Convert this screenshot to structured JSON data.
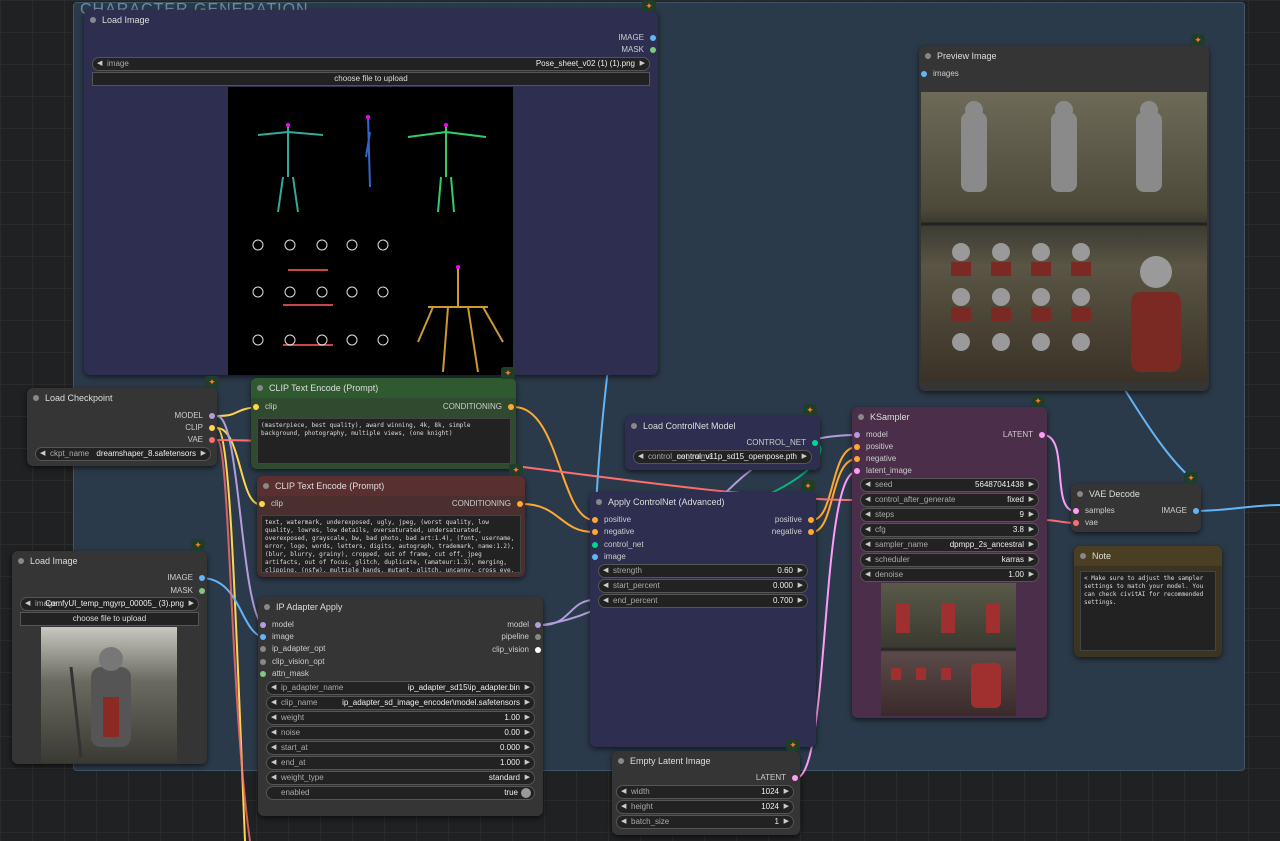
{
  "colors": {
    "canvas": "#202122",
    "group": "#2b3a4a",
    "node": "#353535",
    "clip_green": "#2f4a2f",
    "clip_red": "#4a2f2f",
    "blue_node": "#2e2e50",
    "purple_node": "#4a2e4a",
    "note": "#3a3420"
  },
  "group": {
    "title": "CHARACTER GENERATION"
  },
  "load_image_top": {
    "title": "Load Image",
    "out_image": "IMAGE",
    "out_mask": "MASK",
    "image_label": "image",
    "image_value": "Pose_sheet_v02 (1) (1).png",
    "upload": "choose file to upload"
  },
  "preview": {
    "title": "Preview Image",
    "in_images": "images"
  },
  "checkpoint": {
    "title": "Load Checkpoint",
    "out_model": "MODEL",
    "out_clip": "CLIP",
    "out_vae": "VAE",
    "ckpt_label": "ckpt_name",
    "ckpt_value": "dreamshaper_8.safetensors"
  },
  "clip_pos": {
    "title": "CLIP Text Encode (Prompt)",
    "in_clip": "clip",
    "out": "CONDITIONING",
    "text": "(masterpiece, best quality), award winning, 4k, 8k, simple background, photography, multiple views, (one knight)"
  },
  "clip_neg": {
    "title": "CLIP Text Encode (Prompt)",
    "in_clip": "clip",
    "out": "CONDITIONING",
    "text": "text, watermark, underexposed, ugly, jpeg, (worst quality, low quality, lowres, low details, oversaturated, undersaturated, overexposed, grayscale, bw, bad photo, bad art:1.4), (font, username, error, logo, words, letters, digits, autograph, trademark, name:1.2), (blur, blurry, grainy), cropped, out of frame, cut off, jpeg artifacts, out of focus, glitch, duplicate, (amateur:1.3), merging, clipping, (nsfw), multiple hands, mutant, glitch, uncanny, cross eye, broken face, astronaut, helmet, blurry,"
  },
  "controlnet_loader": {
    "title": "Load ControlNet Model",
    "out": "CONTROL_NET",
    "label": "control_net_name",
    "value": "control_v11p_sd15_openpose.pth"
  },
  "apply_cn": {
    "title": "Apply ControlNet (Advanced)",
    "in_positive": "positive",
    "in_negative": "negative",
    "in_control_net": "control_net",
    "in_image": "image",
    "out_positive": "positive",
    "out_negative": "negative",
    "strength_label": "strength",
    "strength": "0.60",
    "start_label": "start_percent",
    "start": "0.000",
    "end_label": "end_percent",
    "end": "0.700"
  },
  "ksampler": {
    "title": "KSampler",
    "in_model": "model",
    "in_positive": "positive",
    "in_negative": "negative",
    "in_latent": "latent_image",
    "out": "LATENT",
    "widgets": [
      {
        "label": "seed",
        "value": "56487041438"
      },
      {
        "label": "control_after_generate",
        "value": "fixed"
      },
      {
        "label": "steps",
        "value": "9"
      },
      {
        "label": "cfg",
        "value": "3.8"
      },
      {
        "label": "sampler_name",
        "value": "dpmpp_2s_ancestral"
      },
      {
        "label": "scheduler",
        "value": "karras"
      },
      {
        "label": "denoise",
        "value": "1.00"
      }
    ]
  },
  "vae_decode": {
    "title": "VAE Decode",
    "in_samples": "samples",
    "in_vae": "vae",
    "out": "IMAGE"
  },
  "note": {
    "title": "Note",
    "text": "< Make sure to adjust the sampler settings to match your model. You can check civitAI for recommended settings."
  },
  "load_image_bottom": {
    "title": "Load Image",
    "out_image": "IMAGE",
    "out_mask": "MASK",
    "image_label": "image",
    "image_value": "ComfyUI_temp_mgyrp_00005_ (3).png",
    "upload": "choose file to upload"
  },
  "ip_adapter": {
    "title": "IP Adapter Apply",
    "in_model": "model",
    "in_image": "image",
    "in_ip_opt": "ip_adapter_opt",
    "in_clip_vision_opt": "clip_vision_opt",
    "in_attn_mask": "attn_mask",
    "out_model": "model",
    "out_pipeline": "pipeline",
    "out_clip_vision": "clip_vision",
    "widgets": [
      {
        "label": "ip_adapter_name",
        "value": "ip_adapter_sd15\\ip_adapter.bin"
      },
      {
        "label": "clip_name",
        "value": "ip_adapter_sd_image_encoder\\model.safetensors"
      },
      {
        "label": "weight",
        "value": "1.00"
      },
      {
        "label": "noise",
        "value": "0.00"
      },
      {
        "label": "start_at",
        "value": "0.000"
      },
      {
        "label": "end_at",
        "value": "1.000"
      },
      {
        "label": "weight_type",
        "value": "standard"
      }
    ],
    "enabled_label": "enabled",
    "enabled_value": "true"
  },
  "empty_latent": {
    "title": "Empty Latent Image",
    "out": "LATENT",
    "width_label": "width",
    "width": "1024",
    "height_label": "height",
    "height": "1024",
    "batch_label": "batch_size",
    "batch": "1"
  }
}
